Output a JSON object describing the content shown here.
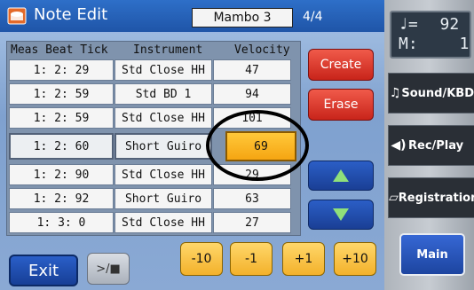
{
  "title": "Note Edit",
  "song": "Mambo 3",
  "page": "4/4",
  "table": {
    "headers": [
      "Meas Beat Tick",
      "Instrument",
      "Velocity"
    ],
    "rows": [
      {
        "pos": "1: 2: 29",
        "instrument": "Std Close HH",
        "velocity": "47"
      },
      {
        "pos": "1: 2: 59",
        "instrument": "Std BD 1",
        "velocity": "94"
      },
      {
        "pos": "1: 2: 59",
        "instrument": "Std Close HH",
        "velocity": "101"
      },
      {
        "pos": "1: 2: 60",
        "instrument": "Short Guiro",
        "velocity": "69"
      },
      {
        "pos": "1: 2: 90",
        "instrument": "Std Close HH",
        "velocity": "29"
      },
      {
        "pos": "1: 2: 92",
        "instrument": "Short Guiro",
        "velocity": "63"
      },
      {
        "pos": "1: 3:  0",
        "instrument": "Std Close HH",
        "velocity": "27"
      }
    ]
  },
  "buttons": {
    "create": "Create",
    "erase": "Erase",
    "exit": "Exit",
    "play_stop": ">/■",
    "minus10": "-10",
    "minus1": "-1",
    "plus1": "+1",
    "plus10": "+10"
  },
  "tempo": {
    "note_symbol": "♩=",
    "bpm": "92",
    "measure_label": "M:",
    "measure": "1"
  },
  "side": {
    "sound": "Sound/KBD",
    "recplay": "Rec/Play",
    "registration": "Registration",
    "main": "Main"
  },
  "colors": {
    "title_bar": "#1f55a8",
    "selected_velocity": "#f5a512",
    "red_button": "#c8241a",
    "arrow_button": "#1a3f95"
  }
}
